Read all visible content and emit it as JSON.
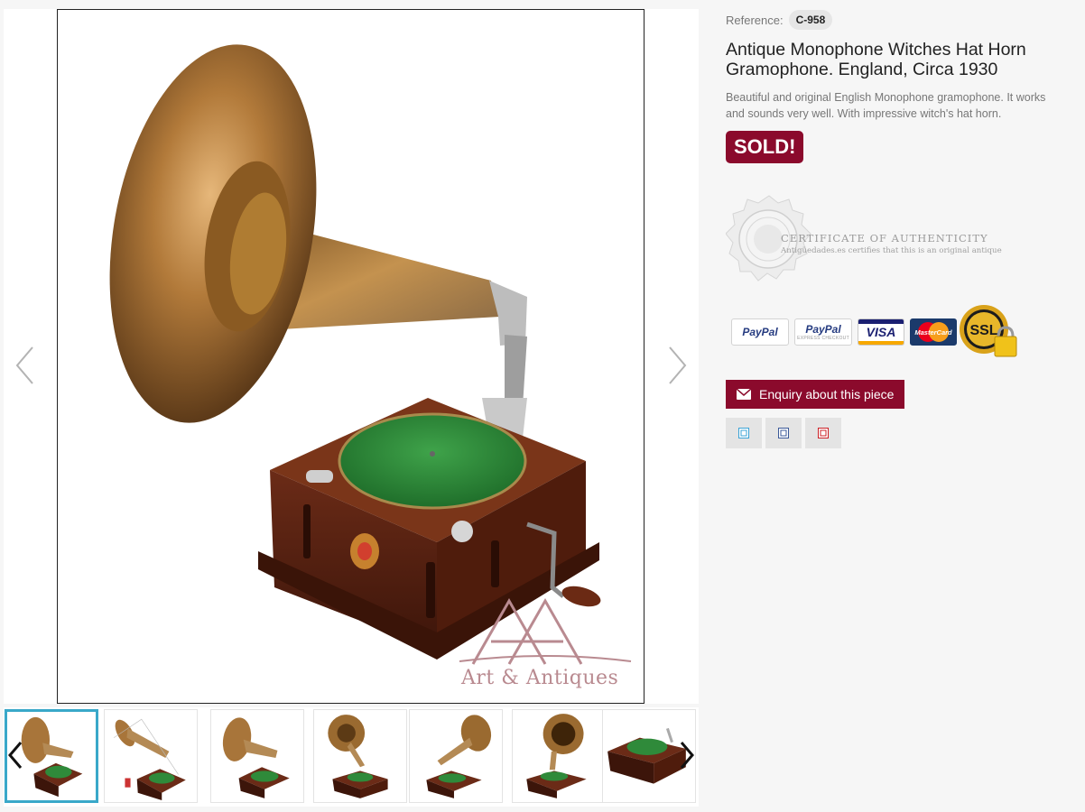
{
  "gallery": {
    "watermark_text": "Art & Antiques",
    "prev_icon": "chevron-left-icon",
    "next_icon": "chevron-right-icon"
  },
  "thumbnails": {
    "count": 7,
    "active_index": 0
  },
  "product": {
    "reference_label": "Reference:",
    "reference_value": "C-958",
    "title": "Antique Monophone Witches Hat Horn Gramophone. England, Circa 1930",
    "description": "Beautiful and original English Monophone gramophone. It works and sounds very well. With impressive witch's hat horn.",
    "status_badge": "SOLD!"
  },
  "certificate": {
    "title": "CERTIFICATE OF AUTHENTICITY",
    "subtitle": "Antigüedades.es certifies that this is an original antique"
  },
  "payments": {
    "paypal_1": "PayPal",
    "paypal_2": "PayPal",
    "paypal_2_sub": "EXPRESS CHECKOUT",
    "visa": "VISA",
    "mastercard": "MasterCard",
    "ssl": "SSL"
  },
  "actions": {
    "enquiry_label": "Enquiry about this piece",
    "share_icons": [
      "share-icon-1",
      "share-icon-2",
      "share-icon-3"
    ]
  },
  "colors": {
    "brand": "#8b0a2c",
    "thumb_active": "#39a8c9",
    "text_muted": "#777777"
  }
}
